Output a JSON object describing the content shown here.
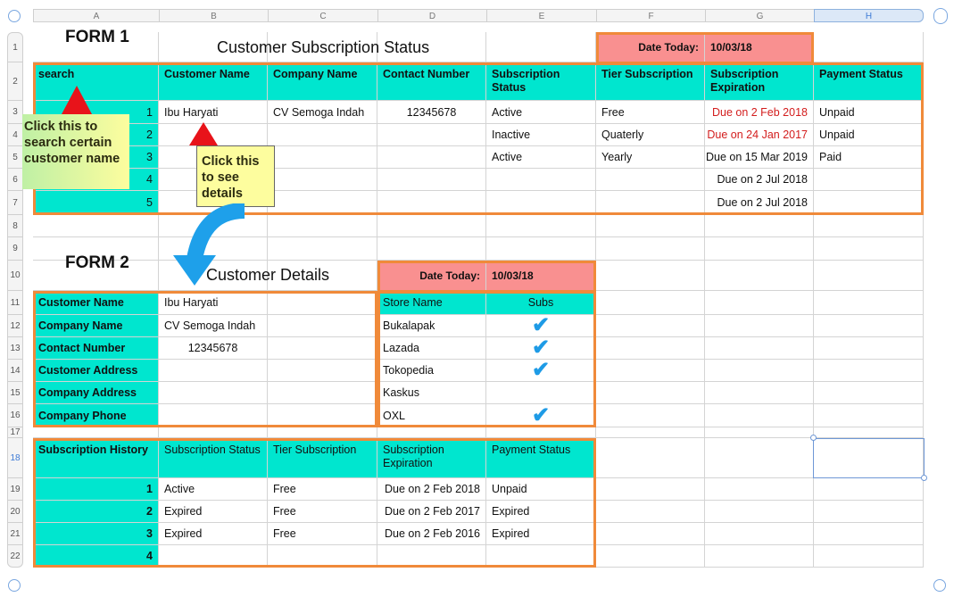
{
  "columns": [
    "A",
    "B",
    "C",
    "D",
    "E",
    "F",
    "G",
    "H"
  ],
  "rows": [
    "1",
    "2",
    "3",
    "4",
    "5",
    "6",
    "7",
    "8",
    "9",
    "10",
    "11",
    "12",
    "13",
    "14",
    "15",
    "16",
    "17",
    "18",
    "19",
    "20",
    "21",
    "22"
  ],
  "form1": {
    "label": "FORM 1",
    "title": "Customer Subscription Status",
    "date_label": "Date Today:",
    "date_value": "10/03/18",
    "headers": [
      "search",
      "Customer Name",
      "Company Name",
      "Contact Number",
      "Subscription Status",
      "Tier Subscription",
      "Subscription Expiration",
      "Payment Status"
    ],
    "rows": [
      {
        "num": "1",
        "customer": "Ibu Haryati",
        "company": "CV Semoga Indah",
        "contact": "12345678",
        "status": "Active",
        "tier": "Free",
        "expiration": "Due on 2 Feb 2018",
        "payment": "Unpaid"
      },
      {
        "num": "2",
        "customer": "",
        "company": "",
        "contact": "",
        "status": "Inactive",
        "tier": "Quaterly",
        "expiration": "Due on 24 Jan 2017",
        "payment": "Unpaid"
      },
      {
        "num": "3",
        "customer": "",
        "company": "",
        "contact": "",
        "status": "Active",
        "tier": "Yearly",
        "expiration": "Due on 15 Mar 2019",
        "payment": "Paid"
      },
      {
        "num": "4",
        "customer": "",
        "company": "",
        "contact": "",
        "status": "",
        "tier": "",
        "expiration": "Due on 2 Jul 2018",
        "payment": ""
      },
      {
        "num": "5",
        "customer": "",
        "company": "",
        "contact": "",
        "status": "",
        "tier": "",
        "expiration": "Due on 2 Jul 2018",
        "payment": ""
      }
    ]
  },
  "form2": {
    "label": "FORM 2",
    "title": "Customer Details",
    "date_label": "Date Today:",
    "date_value": "10/03/18",
    "details": [
      {
        "label": "Customer Name",
        "value": "Ibu Haryati"
      },
      {
        "label": "Company Name",
        "value": "CV Semoga Indah"
      },
      {
        "label": "Contact Number",
        "value": "12345678"
      },
      {
        "label": "Customer Address",
        "value": ""
      },
      {
        "label": "Company Address",
        "value": ""
      },
      {
        "label": "Company Phone",
        "value": ""
      }
    ],
    "stores_header": {
      "name": "Store Name",
      "subs": "Subs"
    },
    "stores": [
      {
        "name": "Bukalapak",
        "subscribed": true
      },
      {
        "name": "Lazada",
        "subscribed": true
      },
      {
        "name": "Tokopedia",
        "subscribed": true
      },
      {
        "name": "Kaskus",
        "subscribed": false
      },
      {
        "name": "OXL",
        "subscribed": true
      }
    ],
    "history_headers": [
      "Subscription History",
      "Subscription Status",
      "Tier Subscription",
      "Subscription Expiration",
      "Payment Status"
    ],
    "history": [
      {
        "num": "1",
        "status": "Active",
        "tier": "Free",
        "expiration": "Due on 2 Feb 2018",
        "payment": "Unpaid"
      },
      {
        "num": "2",
        "status": "Expired",
        "tier": "Free",
        "expiration": "Due on 2 Feb 2017",
        "payment": "Expired"
      },
      {
        "num": "3",
        "status": "Expired",
        "tier": "Free",
        "expiration": "Due on 2 Feb 2016",
        "payment": "Expired"
      },
      {
        "num": "4",
        "status": "",
        "tier": "",
        "expiration": "",
        "payment": ""
      }
    ]
  },
  "notes": {
    "search_note": "Click this to search certain customer name",
    "details_note": "Click this to see details"
  },
  "colors": {
    "teal": "#00e6cf",
    "pink": "#f99090",
    "orange_border": "#f08a3a",
    "red_text": "#d31d1d",
    "check": "#1e9be6",
    "note_yellow": "#fdfd9e"
  }
}
